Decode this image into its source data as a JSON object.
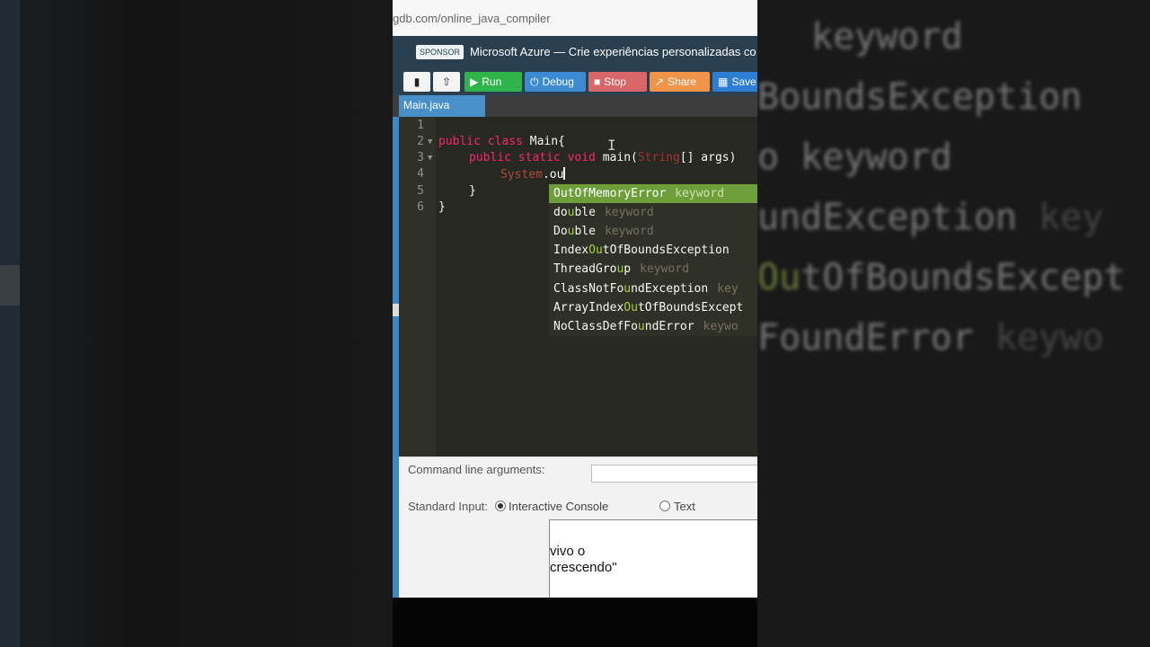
{
  "browser": {
    "url": "gdb.com/online_java_compiler"
  },
  "sponsor": {
    "badge": "SPONSOR",
    "text": "Microsoft Azure — Crie experiências personalizadas co"
  },
  "toolbar": {
    "run_label": "Run",
    "debug_label": "Debug",
    "stop_label": "Stop",
    "share_label": "Share",
    "save_label": "Save"
  },
  "tabs": [
    {
      "label": "Main.java",
      "active": true
    }
  ],
  "editor": {
    "line_numbers": [
      "1",
      "2",
      "3",
      "4",
      "5",
      "6"
    ],
    "lines": {
      "l2_kw": "public class",
      "l2_rest": " Main{",
      "l3_kw": "public static void",
      "l3_name": " main(",
      "l3_type": "String",
      "l3_rest": "[] args)",
      "l4_sys": "System",
      "l4_rest": ".ou",
      "l5": "}",
      "l6": "}"
    },
    "cursor_glyph": "I"
  },
  "autocomplete": [
    {
      "pre": "",
      "match": "OutOfMemoryError",
      "post": "",
      "meta": "keyword",
      "selected": true
    },
    {
      "pre": "do",
      "match": "u",
      "post": "ble",
      "meta": "keyword"
    },
    {
      "pre": "Do",
      "match": "u",
      "post": "ble",
      "meta": "keyword"
    },
    {
      "pre": "Index",
      "match": "Ou",
      "post": "tOfBoundsException",
      "meta": ""
    },
    {
      "pre": "ThreadGro",
      "match": "u",
      "post": "p",
      "meta": "keyword"
    },
    {
      "pre": "ClassNotFo",
      "match": "u",
      "post": "ndException",
      "meta": "key"
    },
    {
      "pre": "ArrayIndex",
      "match": "Ou",
      "post": "tOfBoundsExcept",
      "meta": ""
    },
    {
      "pre": "NoClassDefFo",
      "match": "u",
      "post": "ndError",
      "meta": "keywo"
    }
  ],
  "io": {
    "cmd_label": "Command line arguments:",
    "stdin_label": "Standard Input:",
    "interactive_label": "Interactive Console",
    "text_label": "Text",
    "console_text": "vivo o\ncrescendo\""
  },
  "background_left": {},
  "background_right": {
    "lines": [
      {
        "g": "",
        "w": "keyword",
        "k": ""
      },
      {
        "g": "",
        "w": "BoundsException",
        "k": ""
      },
      {
        "g": "",
        "w": "o  keyword",
        "k": ""
      },
      {
        "g": "",
        "w": "undException",
        "k": "  key"
      },
      {
        "g": "Ou",
        "w": "tOfBoundsExcept",
        "k": ""
      },
      {
        "g": "",
        "w": "FoundError",
        "k": "  keywo"
      }
    ]
  },
  "colors": {
    "accent_run": "#2fb44a",
    "accent_debug": "#3c8ad1",
    "accent_stop": "#d9676a",
    "accent_share": "#f0944a",
    "accent_save": "#2d7dd2",
    "editor_bg": "#272822",
    "autocomplete_selected": "#6e9e39"
  }
}
